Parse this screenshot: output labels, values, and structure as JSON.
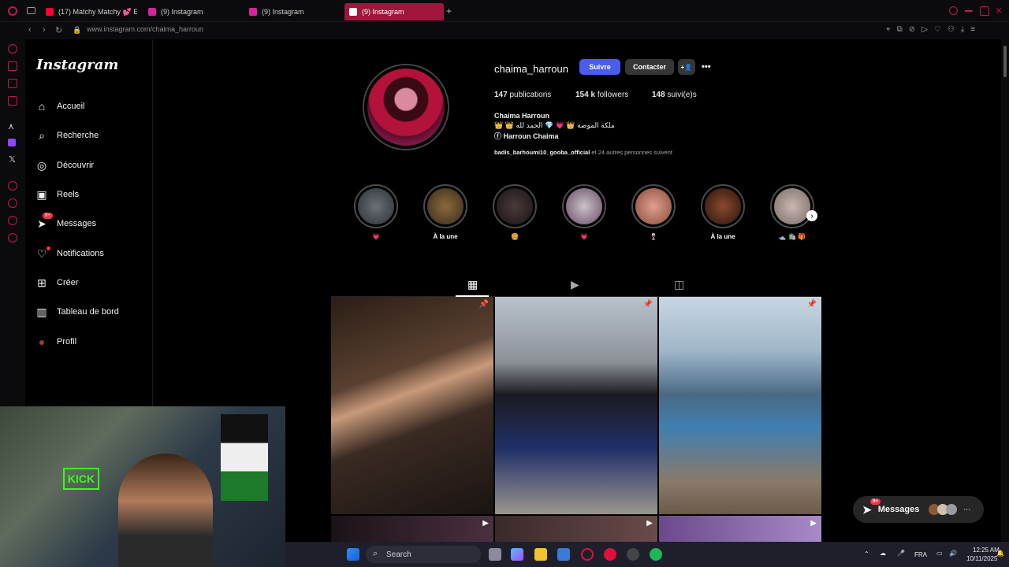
{
  "browser": {
    "tabs": [
      {
        "label": "(17) Matchy Matchy 💕 E",
        "fav_color": "#ff0033"
      },
      {
        "label": "(9) Instagram",
        "fav_color": "#d6249f"
      },
      {
        "label": "(9) Instagram",
        "fav_color": "#d6249f"
      },
      {
        "label": "(9) Instagram",
        "fav_color": "#d6249f"
      }
    ],
    "new_tab": "+",
    "url": "www.instagram.com/chaima_harroun",
    "accent": "#c2184b"
  },
  "sidebar": {
    "logo": "Instagram",
    "items": [
      {
        "label": "Accueil",
        "icon": "⌂"
      },
      {
        "label": "Recherche",
        "icon": "⌕"
      },
      {
        "label": "Découvrir",
        "icon": "◎"
      },
      {
        "label": "Reels",
        "icon": "▣"
      },
      {
        "label": "Messages",
        "icon": "➤",
        "badge": "9+"
      },
      {
        "label": "Notifications",
        "icon": "♡"
      },
      {
        "label": "Créer",
        "icon": "⊞"
      },
      {
        "label": "Tableau de bord",
        "icon": "▥"
      },
      {
        "label": "Profil",
        "icon": "●"
      }
    ]
  },
  "profile": {
    "username": "chaima_harroun",
    "follow_label": "Suivre",
    "contact_label": "Contacter",
    "suggest_icon": "+👤",
    "more_icon": "•••",
    "stats": {
      "posts_n": "147",
      "posts_l": "publications",
      "followers_n": "154 k",
      "followers_l": "followers",
      "following_n": "148",
      "following_l": "suivi(e)s"
    },
    "full_name": "Chaima Harroun",
    "bio_line": "👑 👑 ملكة الموضة 👑 💗 💎 الحمد لله",
    "link_icon": "ⓕ",
    "link_text": "Harroun Chaima",
    "followed_by_1": "badis_barhoumi10",
    "followed_by_sep": ", ",
    "followed_by_2": "gooba_official",
    "followed_by_rest": " et 24 autres personnes suivent"
  },
  "stories": [
    {
      "label": "💗",
      "c1": "#6b7078",
      "c2": "#2b2f36"
    },
    {
      "label": "À la une",
      "c1": "#8a6a3d",
      "c2": "#3a2a1a"
    },
    {
      "label": "🍔",
      "c1": "#4a3a3a",
      "c2": "#1a1414"
    },
    {
      "label": "💗",
      "c1": "#c9c3c8",
      "c2": "#6a4a66"
    },
    {
      "label": "🍷",
      "c1": "#e0a090",
      "c2": "#8a4a3a"
    },
    {
      "label": "À la une",
      "c1": "#8a4a2a",
      "c2": "#2a1410"
    },
    {
      "label": "🛥️ 🛍️ 🎁",
      "c1": "#c9b8b0",
      "c2": "#7a6a66"
    }
  ],
  "story_next": "›",
  "tabs": {
    "grid_icon": "▦",
    "reels_icon": "▶",
    "tagged_icon": "◫"
  },
  "posts_icons": {
    "pin": "📌",
    "reel": "▶"
  },
  "float_messages": {
    "label": "Messages",
    "badge": "9+",
    "more": "···"
  },
  "taskbar": {
    "search": "Search",
    "lang": "FRA",
    "time": "12:25 AM",
    "date": "10/11/2025",
    "bg": "#1f1f2b"
  }
}
